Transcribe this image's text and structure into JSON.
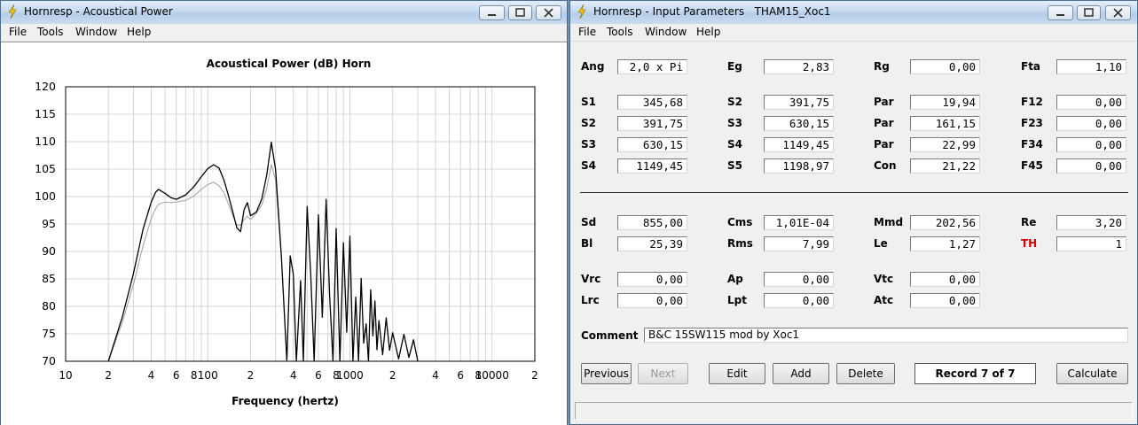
{
  "left_window": {
    "title": "Hornresp - Acoustical Power",
    "menu": [
      "File",
      "Tools",
      "Window",
      "Help"
    ]
  },
  "right_window": {
    "title": "Hornresp - Input Parameters   THAM15_Xoc1",
    "menu": [
      "File",
      "Tools",
      "Window",
      "Help"
    ],
    "rows": [
      [
        {
          "label": "Ang",
          "value": "2,0 x Pi"
        },
        {
          "label": "Eg",
          "value": "2,83"
        },
        {
          "label": "Rg",
          "value": "0,00"
        },
        {
          "label": "Fta",
          "value": "1,10"
        }
      ],
      [
        {
          "label": "S1",
          "value": "345,68"
        },
        {
          "label": "S2",
          "value": "391,75"
        },
        {
          "label": "Par",
          "value": "19,94"
        },
        {
          "label": "F12",
          "value": "0,00"
        }
      ],
      [
        {
          "label": "S2",
          "value": "391,75"
        },
        {
          "label": "S3",
          "value": "630,15"
        },
        {
          "label": "Par",
          "value": "161,15"
        },
        {
          "label": "F23",
          "value": "0,00"
        }
      ],
      [
        {
          "label": "S3",
          "value": "630,15"
        },
        {
          "label": "S4",
          "value": "1149,45"
        },
        {
          "label": "Par",
          "value": "22,99"
        },
        {
          "label": "F34",
          "value": "0,00"
        }
      ],
      [
        {
          "label": "S4",
          "value": "1149,45"
        },
        {
          "label": "S5",
          "value": "1198,97"
        },
        {
          "label": "Con",
          "value": "21,22"
        },
        {
          "label": "F45",
          "value": "0,00"
        }
      ],
      [
        {
          "label": "Sd",
          "value": "855,00"
        },
        {
          "label": "Cms",
          "value": "1,01E-04"
        },
        {
          "label": "Mmd",
          "value": "202,56"
        },
        {
          "label": "Re",
          "value": "3,20"
        }
      ],
      [
        {
          "label": "Bl",
          "value": "25,39"
        },
        {
          "label": "Rms",
          "value": "7,99"
        },
        {
          "label": "Le",
          "value": "1,27"
        },
        {
          "label": "TH",
          "value": "1",
          "color": "#d00000"
        }
      ],
      [
        {
          "label": "Vrc",
          "value": "0,00"
        },
        {
          "label": "Ap",
          "value": "0,00"
        },
        {
          "label": "Vtc",
          "value": "0,00"
        }
      ],
      [
        {
          "label": "Lrc",
          "value": "0,00"
        },
        {
          "label": "Lpt",
          "value": "0,00"
        },
        {
          "label": "Atc",
          "value": "0,00"
        }
      ]
    ],
    "comment_label": "Comment",
    "comment_value": "B&C 15SW115 mod by Xoc1",
    "buttons": {
      "previous": "Previous",
      "next": "Next",
      "edit": "Edit",
      "add": "Add",
      "delete": "Delete",
      "record": "Record 7 of 7",
      "calculate": "Calculate"
    }
  },
  "chart_data": {
    "type": "line",
    "title": "Acoustical Power (dB)   Horn",
    "xlabel": "Frequency (hertz)",
    "ylabel": "",
    "x_scale": "log",
    "xlim": [
      10,
      20000
    ],
    "ylim": [
      70,
      120
    ],
    "x_tick_labels": [
      "10",
      "2",
      "4",
      "6",
      "8",
      "100",
      "2",
      "4",
      "6",
      "8",
      "1000",
      "2",
      "4",
      "6",
      "8",
      "10000",
      "2"
    ],
    "y_tick_labels": [
      "120",
      "115",
      "110",
      "105",
      "100",
      "95",
      "90",
      "85",
      "80",
      "75",
      "70"
    ],
    "grid": true,
    "legend": "none",
    "series": [
      {
        "color": "#000000",
        "x": [
          20,
          25,
          30,
          35,
          40,
          43,
          45,
          50,
          55,
          60,
          70,
          80,
          90,
          100,
          110,
          120,
          130,
          140,
          150,
          160,
          170,
          180,
          190,
          200,
          220,
          240,
          260,
          280,
          300,
          330,
          360,
          380,
          400,
          420,
          450,
          470,
          500,
          530,
          560,
          600,
          640,
          680,
          720,
          760,
          800,
          850,
          900,
          950,
          1000,
          1050,
          1100,
          1150,
          1200,
          1250,
          1300,
          1350,
          1400,
          1450,
          1500,
          1550,
          1600,
          1700,
          1800,
          1900,
          2000,
          2200,
          2400,
          2600,
          2800,
          3000
        ],
        "y": [
          70,
          78,
          86,
          94,
          99,
          100.8,
          101.3,
          100.6,
          99.8,
          99.5,
          100.3,
          101.8,
          103.6,
          105.1,
          105.8,
          105.2,
          103,
          100.1,
          97.2,
          94.3,
          93.6,
          97.6,
          98.9,
          96.5,
          97.2,
          99.6,
          104,
          109.9,
          104.9,
          88.9,
          70,
          89.2,
          85.8,
          70,
          84.7,
          70,
          98.2,
          85.9,
          70,
          96.7,
          78,
          99.5,
          82.1,
          70,
          94.2,
          70,
          91.6,
          75.3,
          92.8,
          70,
          81.7,
          70,
          85.1,
          73.3,
          76.8,
          70,
          83,
          74.6,
          81,
          72.1,
          77.4,
          71.2,
          77.9,
          72,
          75.2,
          70.4,
          74.9,
          70.7,
          73.9,
          70
        ]
      },
      {
        "color": "#a0a0a0",
        "x": [
          20,
          25,
          30,
          35,
          40,
          43,
          45,
          50,
          55,
          60,
          70,
          80,
          90,
          100,
          110,
          120,
          130,
          140,
          150,
          160,
          170,
          180,
          190,
          200,
          220,
          240,
          260,
          280,
          300,
          330
        ],
        "y": [
          70,
          77,
          84,
          91,
          96,
          97.8,
          98.6,
          99,
          98.9,
          99,
          99.3,
          100.1,
          101.3,
          102.2,
          102.6,
          102,
          100.7,
          98.6,
          96.5,
          94.8,
          94.8,
          95.8,
          96.4,
          95.8,
          97,
          98.5,
          101.5,
          105.8,
          103,
          88.9
        ]
      }
    ]
  }
}
